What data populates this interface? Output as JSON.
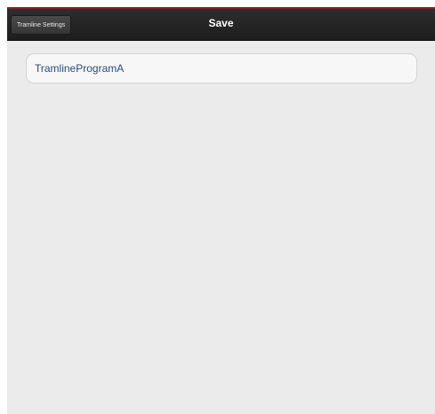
{
  "navbar": {
    "back_label": "Tramline Settings",
    "title": "Save"
  },
  "form": {
    "program_name": "TramlineProgramA"
  },
  "colors": {
    "accent": "#8b1f24",
    "navbar_bg": "#222222",
    "page_bg": "#ebebeb",
    "field_text": "#2e4a7d"
  }
}
